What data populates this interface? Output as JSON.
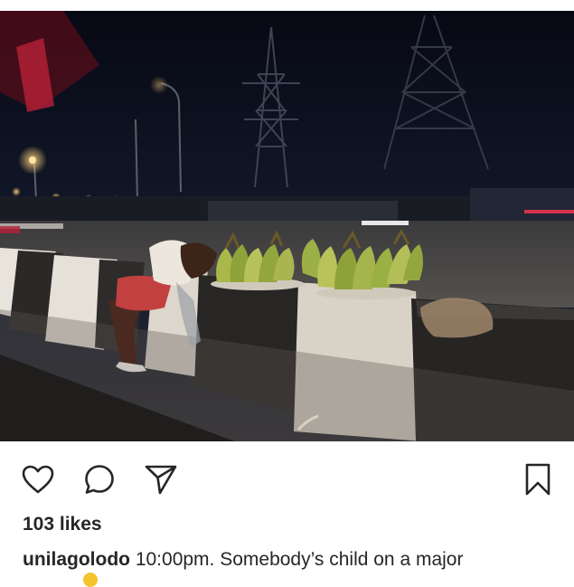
{
  "post": {
    "likes_text": "103 likes",
    "username": "unilagolodo",
    "caption_text": " 10:00pm. Somebody’s child on a major"
  },
  "actions": {
    "like_icon": "heart-outline-icon",
    "comment_icon": "speech-bubble-icon",
    "share_icon": "paper-plane-icon",
    "save_icon": "bookmark-outline-icon"
  },
  "colors": {
    "text": "#262626",
    "background": "#ffffff",
    "plantain": "#9bb043",
    "night_sky": "#0d0f18"
  }
}
